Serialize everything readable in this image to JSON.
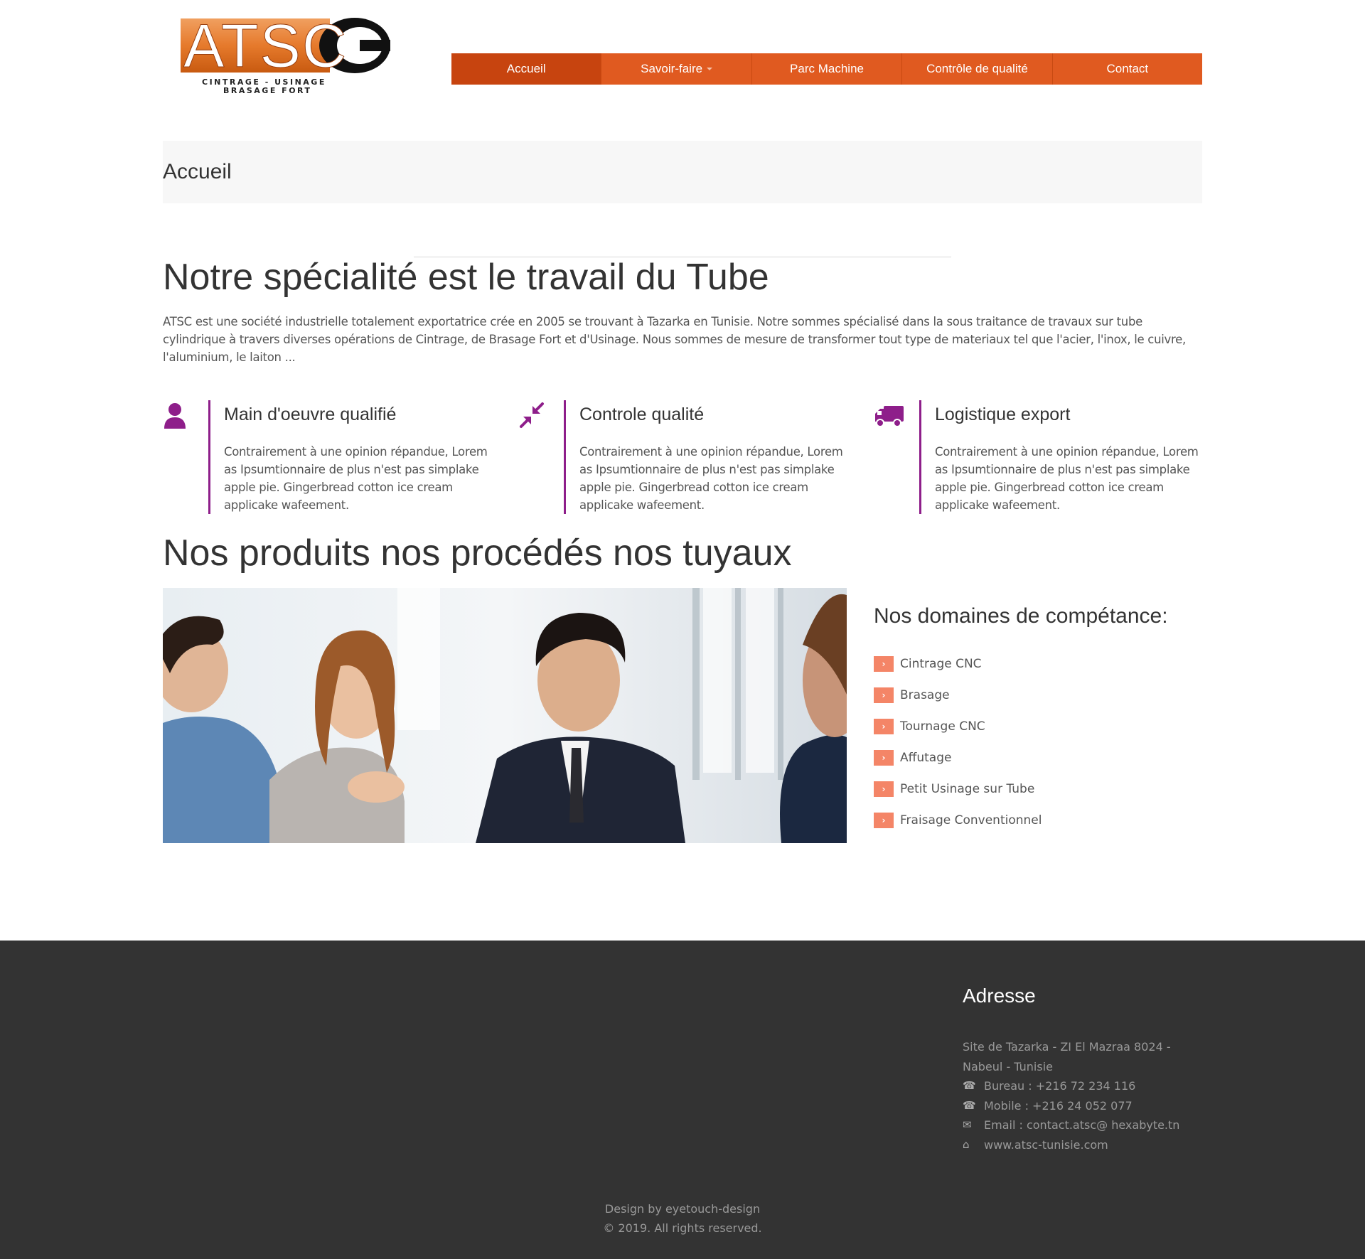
{
  "logo": {
    "letters": "ATSC",
    "tagline_1": "CINTRAGE - USINAGE",
    "tagline_2": "BRASAGE FORT"
  },
  "nav": {
    "items": [
      {
        "label": "Accueil",
        "active": true
      },
      {
        "label": "Savoir-faire",
        "dropdown": true
      },
      {
        "label": "Parc Machine"
      },
      {
        "label": "Contrôle de qualité"
      },
      {
        "label": "Contact"
      }
    ]
  },
  "page_title": "Accueil",
  "section1": {
    "title": "Notre spécialité est le travail du Tube",
    "intro": "ATSC est une société industrielle totalement exportatrice crée en 2005 se trouvant à Tazarka en Tunisie. Notre sommes spécialisé dans la sous traitance de travaux sur tube cylindrique à travers diverses opérations de Cintrage, de Brasage Fort et d'Usinage. Nous sommes de mesure de transformer tout type de materiaux tel que l'acier, l'inox, le cuivre, l'aluminium, le laiton ..."
  },
  "features": [
    {
      "icon": "user-icon",
      "title": "Main d'oeuvre qualifié",
      "text": "Contrairement à une opinion répandue, Lorem as Ipsumtionnaire de plus n'est pas simplake apple pie. Gingerbread cotton ice cream applicake wafeement."
    },
    {
      "icon": "compress-icon",
      "title": "Controle qualité",
      "text": "Contrairement à une opinion répandue, Lorem as Ipsumtionnaire de plus n'est pas simplake apple pie. Gingerbread cotton ice cream applicake wafeement."
    },
    {
      "icon": "truck-icon",
      "title": "Logistique export",
      "text": "Contrairement à une opinion répandue, Lorem as Ipsumtionnaire de plus n'est pas simplake apple pie. Gingerbread cotton ice cream applicake wafeement."
    }
  ],
  "section2": {
    "title": "Nos produits nos procédés nos tuyaux",
    "domains_title": "Nos domaines de compétance:",
    "domains": [
      "Cintrage CNC",
      "Brasage",
      "Tournage CNC",
      "Affutage",
      "Petit Usinage sur Tube",
      "Fraisage Conventionnel"
    ]
  },
  "footer": {
    "address_title": "Adresse",
    "address": "Site de Tazarka - ZI El Mazraa 8024 - Nabeul - Tunisie",
    "bureau": "Bureau : +216 72 234 116",
    "mobile": "Mobile : +216 24 052 077",
    "email": "Email : contact.atsc@ hexabyte.tn",
    "website": "www.atsc-tunisie.com",
    "design_by": "Design by eyetouch-design",
    "copyright": "© 2019. All rights reserved."
  },
  "colors": {
    "nav_bg": "#e05a20",
    "nav_active": "#c7440f",
    "accent_purple": "#8e1e8a",
    "list_arrow": "#f48567",
    "footer_bg": "#333333"
  }
}
